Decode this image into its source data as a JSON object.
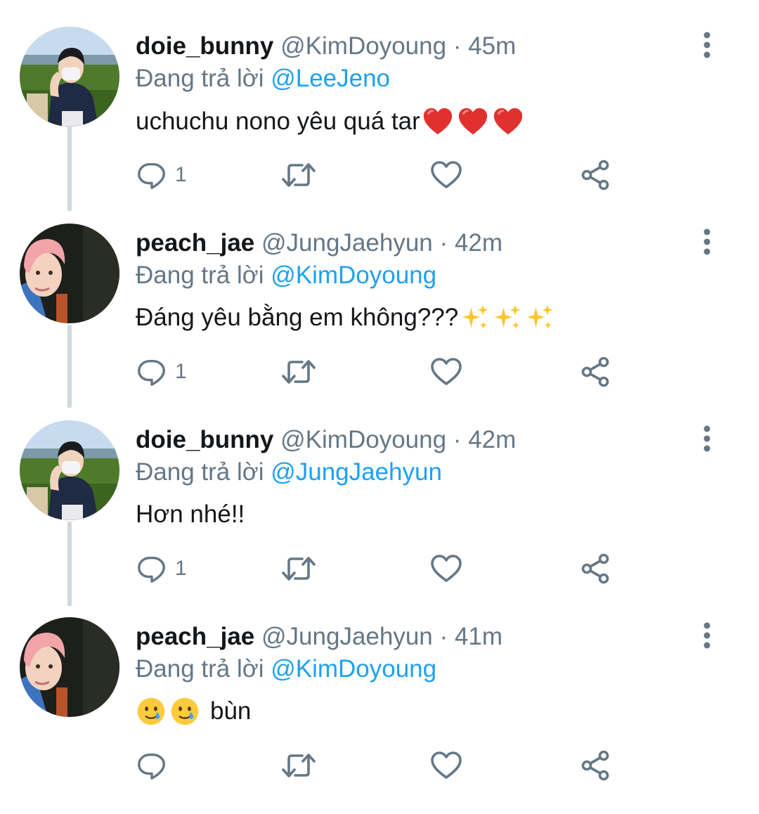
{
  "colors": {
    "text": "#14171a",
    "secondary": "#657786",
    "link": "#1da1f2",
    "thread_line": "#cfd9de"
  },
  "icons": {
    "reply": "speech-bubble-icon",
    "retweet": "retweet-icon",
    "like": "heart-icon",
    "share": "share-icon",
    "more": "vertical-dots-icon"
  },
  "tweets": [
    {
      "display_name": "doie_bunny",
      "handle": "@KimDoyoung",
      "separator": "·",
      "time": "45m",
      "replying_label": "Đang trả lời",
      "replying_to": "@LeeJeno",
      "text": "uchuchu nono yêu quá tar",
      "emoji": "red-heart x3",
      "reply_count": "1"
    },
    {
      "display_name": "peach_jae",
      "handle": "@JungJaehyun",
      "separator": "·",
      "time": "42m",
      "replying_label": "Đang trả lời",
      "replying_to": "@KimDoyoung",
      "text": "Đáng yêu bằng em không???",
      "emoji": "sparkles x3",
      "reply_count": "1"
    },
    {
      "display_name": "doie_bunny",
      "handle": "@KimDoyoung",
      "separator": "·",
      "time": "42m",
      "replying_label": "Đang trả lời",
      "replying_to": "@JungJaehyun",
      "text": "Hơn nhé!!",
      "emoji": "",
      "reply_count": "1"
    },
    {
      "display_name": "peach_jae",
      "handle": "@JungJaehyun",
      "separator": "·",
      "time": "41m",
      "replying_label": "Đang trả lời",
      "replying_to": "@KimDoyoung",
      "text": "bùn",
      "emoji": "smiling-face-with-tear x2",
      "reply_count": ""
    }
  ]
}
